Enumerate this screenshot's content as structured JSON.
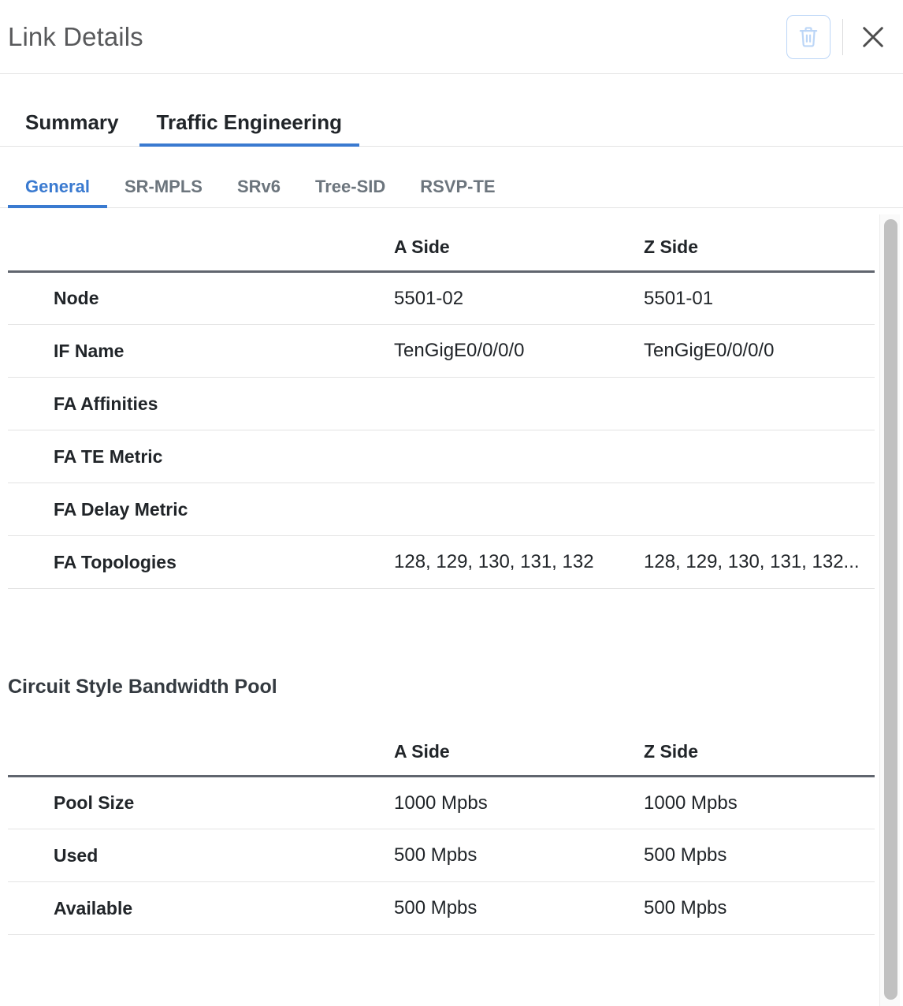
{
  "header": {
    "title": "Link Details",
    "delete_icon": "trash-icon",
    "close_icon": "close-icon"
  },
  "tabs_primary": [
    {
      "label": "Summary",
      "active": false
    },
    {
      "label": "Traffic Engineering",
      "active": true
    }
  ],
  "tabs_secondary": [
    {
      "label": "General",
      "active": true
    },
    {
      "label": "SR-MPLS",
      "active": false
    },
    {
      "label": "SRv6",
      "active": false
    },
    {
      "label": "Tree-SID",
      "active": false
    },
    {
      "label": "RSVP-TE",
      "active": false
    }
  ],
  "general_table": {
    "columns": [
      "",
      "A Side",
      "Z Side"
    ],
    "rows": [
      {
        "label": "Node",
        "a": "5501-02",
        "z": "5501-01"
      },
      {
        "label": "IF Name",
        "a": "TenGigE0/0/0/0",
        "z": "TenGigE0/0/0/0"
      },
      {
        "label": "FA Affinities",
        "a": "",
        "z": ""
      },
      {
        "label": "FA TE Metric",
        "a": "",
        "z": ""
      },
      {
        "label": "FA Delay Metric",
        "a": "",
        "z": ""
      },
      {
        "label": "FA Topologies",
        "a": "128, 129, 130, 131, 132",
        "z": "128, 129, 130, 131, 132..."
      }
    ]
  },
  "bandwidth_pool": {
    "heading": "Circuit Style Bandwidth Pool",
    "columns": [
      "",
      "A Side",
      "Z Side"
    ],
    "rows": [
      {
        "label": "Pool Size",
        "a": "1000 Mpbs",
        "z": "1000 Mpbs"
      },
      {
        "label": "Used",
        "a": "500 Mpbs",
        "z": "500 Mpbs"
      },
      {
        "label": "Available",
        "a": "500 Mpbs",
        "z": "500 Mpbs"
      }
    ]
  },
  "colors": {
    "accent_blue": "#3a7ad0",
    "delete_icon_blue": "#bcd6f7",
    "title_gray": "#58595b",
    "text_dark": "#212529",
    "muted_tab": "#6c757d",
    "header_rule": "#60656e",
    "row_rule": "#e3e3e3",
    "scrollbar_thumb": "#c1c1c1"
  }
}
